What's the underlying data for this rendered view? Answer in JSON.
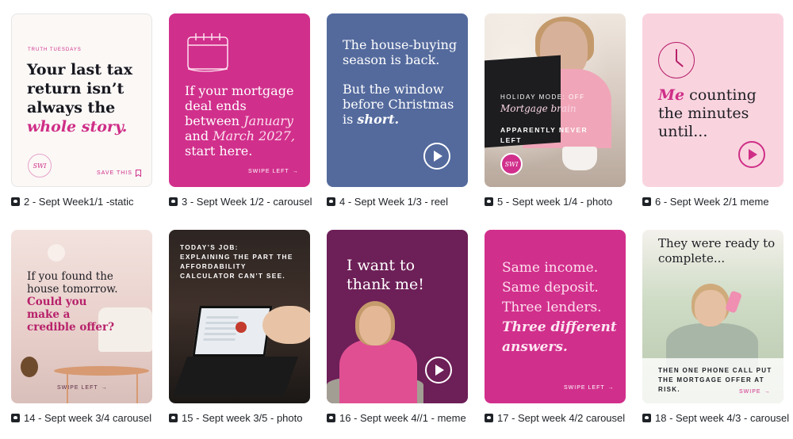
{
  "accent_pink": "#d12f8c",
  "designs": [
    {
      "kicker": "TRUTH TUESDAYS",
      "headline_a": "Your last tax return isn’t always the",
      "headline_em": "whole story.",
      "seal": "SWI",
      "save_label": "SAVE THIS",
      "caption": "2 - Sept Week1/1 -static",
      "icon": "bookmark-icon"
    },
    {
      "headline_a": "If your mortgage deal ends between",
      "headline_em1": "January",
      "headline_b": "and",
      "headline_em2": "March 2027,",
      "headline_c": "start here.",
      "swipe_label": "SWIPE LEFT",
      "caption": "3 - Sept Week 1/2 - carousel",
      "icon": "calendar-icon"
    },
    {
      "headline_a": "The house-buying season is back.",
      "headline_b": "But the window before Christmas is",
      "headline_em": "short.",
      "caption": "4 - Sept Week 1/3 - reel",
      "icon": "play-icon"
    },
    {
      "line1": "HOLIDAY MODE: OFF",
      "line2": "Mortgage brain",
      "line3": "APPARENTLY NEVER LEFT",
      "seal": "SWI",
      "caption": "5 - Sept week 1/4 - photo"
    },
    {
      "headline_em": "Me",
      "headline_a": "counting the minutes until...",
      "caption": "6 - Sept Week 2/1 meme",
      "icon": "clock-icon"
    },
    {
      "headline_a": "If you found the house tomorrow.",
      "headline_em": "Could you make a credible offer?",
      "swipe_label": "SWIPE LEFT",
      "caption": "14 - Sept week 3/4 carousel"
    },
    {
      "line1": "TODAY’S JOB:",
      "line2": "EXPLAINING THE PART THE AFFORDABILITY CALCULATOR CAN’T SEE.",
      "caption": "15 - Sept week 3/5 - photo"
    },
    {
      "headline_a": "I want to thank me!",
      "caption": "16 - Sept week 4//1 - meme"
    },
    {
      "headline_a": "Same income. Same deposit. Three lenders.",
      "headline_em": "Three different answers.",
      "swipe_label": "SWIPE LEFT",
      "caption": "17 - Sept week 4/2 carousel"
    },
    {
      "headline_a": "They were ready to complete...",
      "line1": "THEN ONE PHONE CALL PUT THE MORTGAGE OFFER AT RISK.",
      "swipe_label": "SWIPE",
      "caption": "18 - Sept week 4/3 - carousel"
    }
  ]
}
